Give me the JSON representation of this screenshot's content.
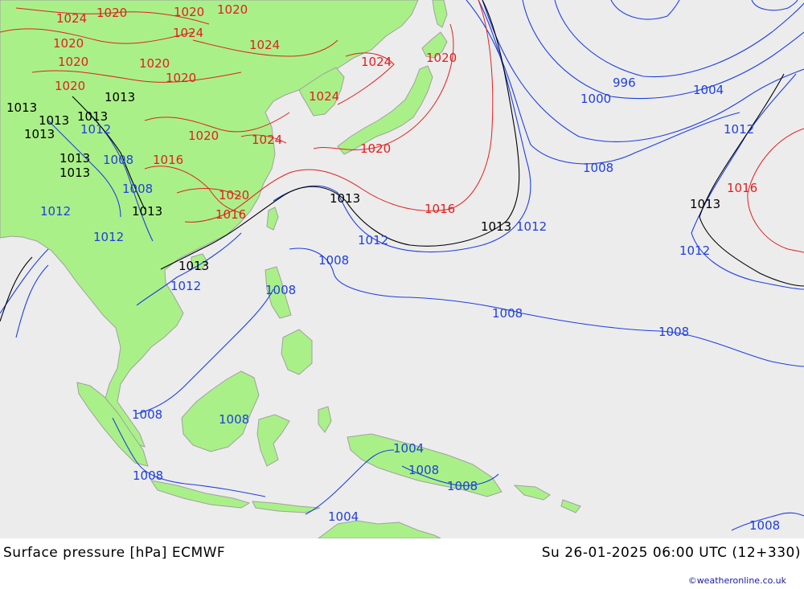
{
  "footer": {
    "left": "Surface pressure [hPa] ECMWF",
    "right": "Su 26-01-2025 06:00 UTC (12+330)",
    "credit": "©weatheronline.co.uk"
  },
  "colors": {
    "ocean": "#ececec",
    "land": "#aaf088",
    "coast": "#a0a0a0",
    "isobar_low": "#1f3fe0",
    "isobar_std": "#000000",
    "isobar_high": "#e02020"
  },
  "isobar_labels": [
    {
      "id": "l-996",
      "text": "996",
      "kind": "low"
    },
    {
      "id": "l-1000",
      "text": "1000",
      "kind": "low"
    },
    {
      "id": "l-1004a",
      "text": "1004",
      "kind": "low"
    },
    {
      "id": "l-1012a",
      "text": "1012",
      "kind": "low"
    },
    {
      "id": "l-1008a",
      "text": "1008",
      "kind": "low"
    },
    {
      "id": "l-1016a",
      "text": "1016",
      "kind": "high"
    },
    {
      "id": "l-1013a",
      "text": "1013",
      "kind": "std"
    },
    {
      "id": "l-1012b",
      "text": "1012",
      "kind": "low"
    },
    {
      "id": "l-1013b",
      "text": "1013",
      "kind": "std"
    },
    {
      "id": "l-1012c",
      "text": "1012",
      "kind": "low"
    },
    {
      "id": "l-1016b",
      "text": "1016",
      "kind": "high"
    },
    {
      "id": "l-1013c",
      "text": "1013",
      "kind": "std"
    },
    {
      "id": "l-1012d",
      "text": "1012",
      "kind": "low"
    },
    {
      "id": "l-1008b",
      "text": "1008",
      "kind": "low"
    },
    {
      "id": "l-1008c",
      "text": "1008",
      "kind": "low"
    },
    {
      "id": "l-1008d",
      "text": "1008",
      "kind": "low"
    },
    {
      "id": "l-1013d",
      "text": "1013",
      "kind": "std"
    },
    {
      "id": "l-1012e",
      "text": "1012",
      "kind": "low"
    },
    {
      "id": "l-1016c",
      "text": "1016",
      "kind": "high"
    },
    {
      "id": "l-1020a",
      "text": "1020",
      "kind": "high"
    },
    {
      "id": "l-1024a",
      "text": "1024",
      "kind": "high"
    },
    {
      "id": "l-1024b",
      "text": "1024",
      "kind": "high"
    },
    {
      "id": "l-1020b",
      "text": "1020",
      "kind": "high"
    },
    {
      "id": "l-1020c",
      "text": "1020",
      "kind": "high"
    },
    {
      "id": "l-1024c",
      "text": "1024",
      "kind": "high"
    },
    {
      "id": "l-1020d",
      "text": "1020",
      "kind": "high"
    },
    {
      "id": "l-1024d",
      "text": "1024",
      "kind": "high"
    },
    {
      "id": "l-1024e",
      "text": "1024",
      "kind": "high"
    },
    {
      "id": "l-1020e",
      "text": "1020",
      "kind": "high"
    },
    {
      "id": "l-1020f",
      "text": "1020",
      "kind": "high"
    },
    {
      "id": "l-1020g",
      "text": "1020",
      "kind": "high"
    },
    {
      "id": "l-1020h",
      "text": "1020",
      "kind": "high"
    },
    {
      "id": "l-1020i",
      "text": "1020",
      "kind": "high"
    },
    {
      "id": "l-1020j",
      "text": "1020",
      "kind": "high"
    },
    {
      "id": "l-1024f",
      "text": "1024",
      "kind": "high"
    },
    {
      "id": "l-1020k",
      "text": "1020",
      "kind": "high"
    },
    {
      "id": "l-1020l",
      "text": "1020",
      "kind": "high"
    },
    {
      "id": "l-1016d",
      "text": "1016",
      "kind": "high"
    },
    {
      "id": "l-1013e",
      "text": "1013",
      "kind": "std"
    },
    {
      "id": "l-1013f",
      "text": "1013",
      "kind": "std"
    },
    {
      "id": "l-1013g",
      "text": "1013",
      "kind": "std"
    },
    {
      "id": "l-1013h",
      "text": "1013",
      "kind": "std"
    },
    {
      "id": "l-1013i",
      "text": "1013",
      "kind": "std"
    },
    {
      "id": "l-1013j",
      "text": "1013",
      "kind": "std"
    },
    {
      "id": "l-1008e",
      "text": "1008",
      "kind": "low"
    },
    {
      "id": "l-1008f",
      "text": "1008",
      "kind": "low"
    },
    {
      "id": "l-1012f",
      "text": "1012",
      "kind": "low"
    },
    {
      "id": "l-1012g",
      "text": "1012",
      "kind": "low"
    },
    {
      "id": "l-1013k",
      "text": "1013",
      "kind": "std"
    },
    {
      "id": "l-1013l",
      "text": "1013",
      "kind": "std"
    },
    {
      "id": "l-1012h",
      "text": "1012",
      "kind": "low"
    },
    {
      "id": "l-1008g",
      "text": "1008",
      "kind": "low"
    },
    {
      "id": "l-1008h",
      "text": "1008",
      "kind": "low"
    },
    {
      "id": "l-1008i",
      "text": "1008",
      "kind": "low"
    },
    {
      "id": "l-1008j",
      "text": "1008",
      "kind": "low"
    },
    {
      "id": "l-1004b",
      "text": "1004",
      "kind": "low"
    },
    {
      "id": "l-1008k",
      "text": "1008",
      "kind": "low"
    },
    {
      "id": "l-1008l",
      "text": "1008",
      "kind": "low"
    },
    {
      "id": "l-1004c",
      "text": "1004",
      "kind": "low"
    },
    {
      "id": "l-1008m",
      "text": "1008",
      "kind": "low"
    }
  ]
}
